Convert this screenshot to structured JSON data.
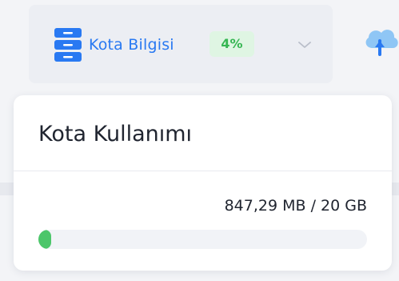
{
  "quota_toggle": {
    "icon": "database-icon",
    "label": "Kota Bilgisi",
    "percent_badge": "4%",
    "chevron_icon": "chevron-down-icon"
  },
  "upload_button": {
    "icon": "cloud-upload-icon"
  },
  "quota_card": {
    "title": "Kota Kullanımı",
    "usage_text": "847,29 MB / 20 GB",
    "progress_fraction": 0.04
  },
  "colors": {
    "accent_blue": "#2979f2",
    "success_green": "#4cc66a",
    "badge_bg": "#dff5e3",
    "badge_text": "#36b653"
  }
}
